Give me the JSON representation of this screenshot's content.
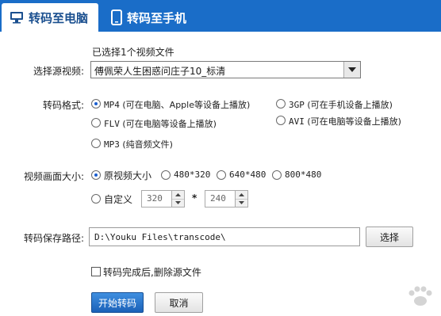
{
  "tabs": [
    {
      "label": "转码至电脑",
      "icon": "monitor-icon",
      "active": true
    },
    {
      "label": "转码至手机",
      "icon": "phone-icon",
      "active": false
    }
  ],
  "source": {
    "selected_info": "已选择1个视频文件",
    "label": "选择源视频:",
    "value": "傅佩荣人生困惑问庄子10_标清"
  },
  "format": {
    "label": "转码格式:",
    "options": [
      {
        "name": "MP4",
        "note": "(可在电脑、Apple等设备上播放)",
        "selected": true
      },
      {
        "name": "3GP",
        "note": "(可在手机设备上播放)",
        "selected": false
      },
      {
        "name": "FLV",
        "note": "(可在电脑等设备上播放)",
        "selected": false
      },
      {
        "name": "AVI",
        "note": "(可在电脑等设备上播放)",
        "selected": false
      },
      {
        "name": "MP3",
        "note": "(纯音频文件)",
        "selected": false
      }
    ]
  },
  "size": {
    "label": "视频画面大小:",
    "options": [
      {
        "name": "原视频大小",
        "selected": true
      },
      {
        "name": "480*320",
        "selected": false
      },
      {
        "name": "640*480",
        "selected": false
      },
      {
        "name": "800*480",
        "selected": false
      },
      {
        "name": "自定义",
        "selected": false
      }
    ],
    "custom_width": "320",
    "separator": "*",
    "custom_height": "240"
  },
  "output": {
    "label": "转码保存路径:",
    "path": "D:\\Youku Files\\transcode\\",
    "browse_label": "选择"
  },
  "delete_source": {
    "label": "转码完成后,删除源文件",
    "checked": false
  },
  "actions": {
    "start_label": "开始转码",
    "cancel_label": "取消"
  },
  "colors": {
    "tabbar": "#1a6dc8",
    "primary_button": "#1b61b8",
    "radio_dot": "#1a5ecf"
  }
}
